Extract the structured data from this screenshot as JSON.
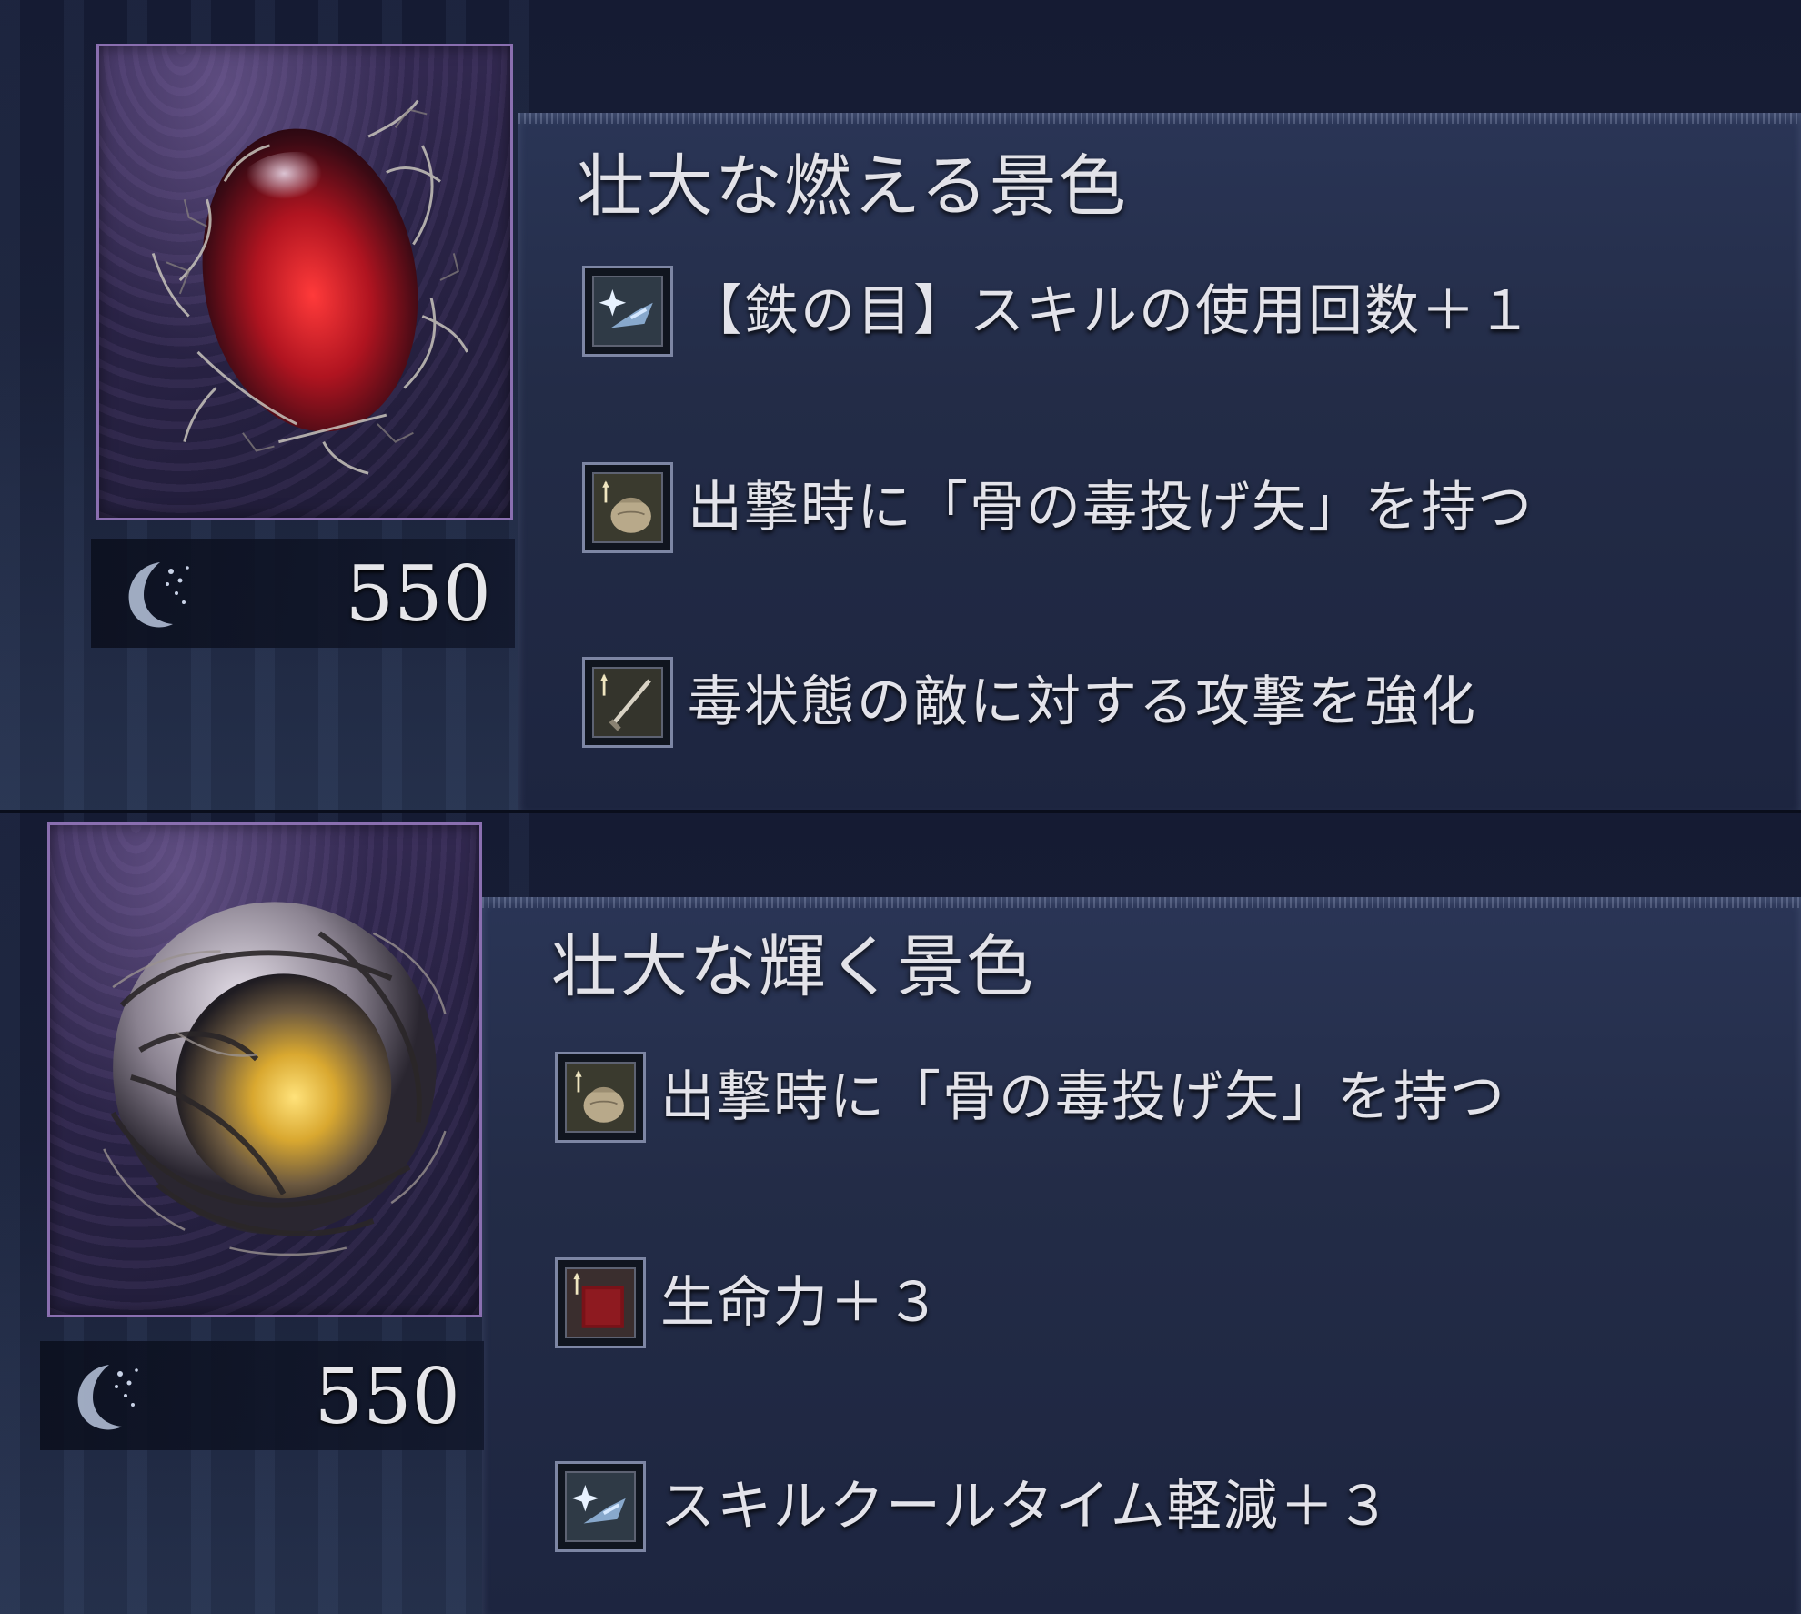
{
  "relics": [
    {
      "name": "壮大な燃える景色",
      "cost": "550",
      "cost_icon": "rune-crescent-icon",
      "gem_color": "#c81c26",
      "effects": [
        {
          "icon": "skill-icon",
          "text": "【鉄の目】スキルの使用回数＋１"
        },
        {
          "icon": "item-pouch-icon",
          "text": "出撃時に「骨の毒投げ矢」を持つ"
        },
        {
          "icon": "weapon-attack-icon",
          "text": "毒状態の敵に対する攻撃を強化"
        }
      ]
    },
    {
      "name": "壮大な輝く景色",
      "cost": "550",
      "cost_icon": "rune-crescent-icon",
      "gem_color": "#e0b53a",
      "effects": [
        {
          "icon": "item-pouch-icon",
          "text": "出撃時に「骨の毒投げ矢」を持つ"
        },
        {
          "icon": "vigor-icon",
          "text": "生命力＋３"
        },
        {
          "icon": "skill-icon",
          "text": "スキルクールタイム軽減＋３"
        }
      ]
    }
  ]
}
